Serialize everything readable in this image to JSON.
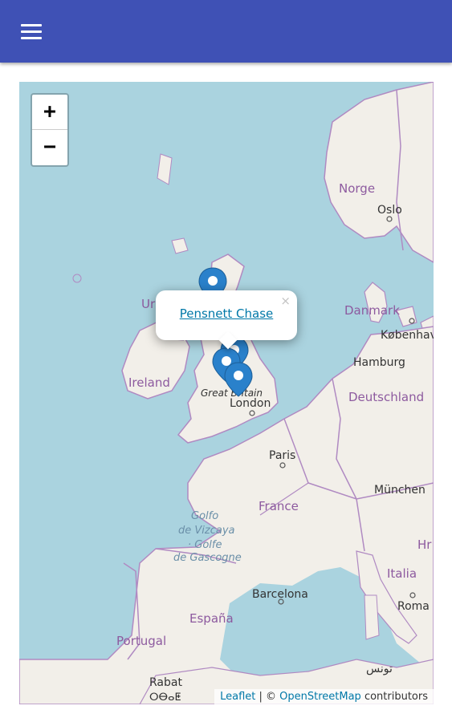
{
  "appbar": {
    "menu_icon": "hamburger-menu-icon",
    "color": "#3f51b5"
  },
  "map": {
    "zoom_in": "+",
    "zoom_out": "−",
    "labels": {
      "norge": "Norge",
      "oslo": "Oslo",
      "danmark": "Danmark",
      "kobenhavn": "København",
      "hamburg": "Hamburg",
      "deutschland": "Deutschland",
      "ireland": "Ireland",
      "uk_partial": "Ur",
      "great_britain": "Great Britain",
      "london": "London",
      "paris": "Paris",
      "france": "France",
      "munchen": "München",
      "golfo1": "Golfo",
      "golfo2": "de Vizcaya",
      "golfo3": "· Golfe",
      "golfo4": "de Gascogne",
      "italia": "Italia",
      "roma": "Roma",
      "barcelona": "Barcelona",
      "espana": "España",
      "portugal": "Portugal",
      "rabat": "Rabat",
      "rabat_tif": "ⵔⴱⴰⵟ",
      "tunis": "تونس",
      "hr_partial": "Hr"
    },
    "popup": {
      "link_text": "Pensnett Chase",
      "close": "×"
    },
    "attribution": {
      "leaflet": "Leaflet",
      "separator": " | © ",
      "osm": "OpenStreetMap",
      "suffix": " contributors"
    },
    "colors": {
      "water": "#aad3df",
      "land": "#f2efe9",
      "marker": "#2a81cb",
      "border": "#b08ac2"
    }
  }
}
